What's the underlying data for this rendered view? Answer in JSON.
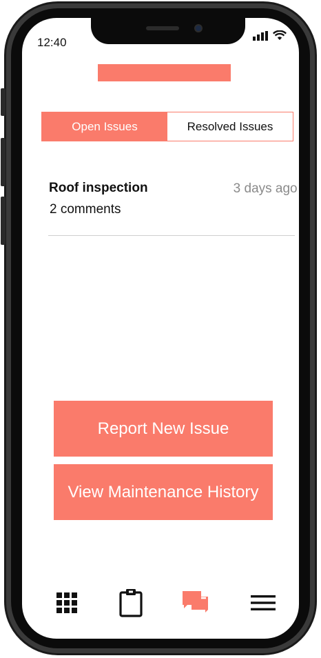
{
  "status_bar": {
    "time": "12:40"
  },
  "tabs": [
    {
      "label": "Open Issues",
      "active": true
    },
    {
      "label": "Resolved Issues",
      "active": false
    }
  ],
  "issues": [
    {
      "title": "Roof inspection",
      "comments": "2 comments",
      "time_ago": "3 days ago >"
    }
  ],
  "actions": {
    "report_label": "Report New Issue",
    "history_label": "View Maintenance History"
  },
  "bottom_nav": [
    {
      "icon": "grid-icon",
      "active": false
    },
    {
      "icon": "clipboard-icon",
      "active": false
    },
    {
      "icon": "chat-icon",
      "active": true
    },
    {
      "icon": "menu-icon",
      "active": false
    }
  ],
  "colors": {
    "accent": "#fa7b6b",
    "text": "#111111",
    "muted": "#8a8a8a",
    "divider": "#cfcfcf"
  }
}
